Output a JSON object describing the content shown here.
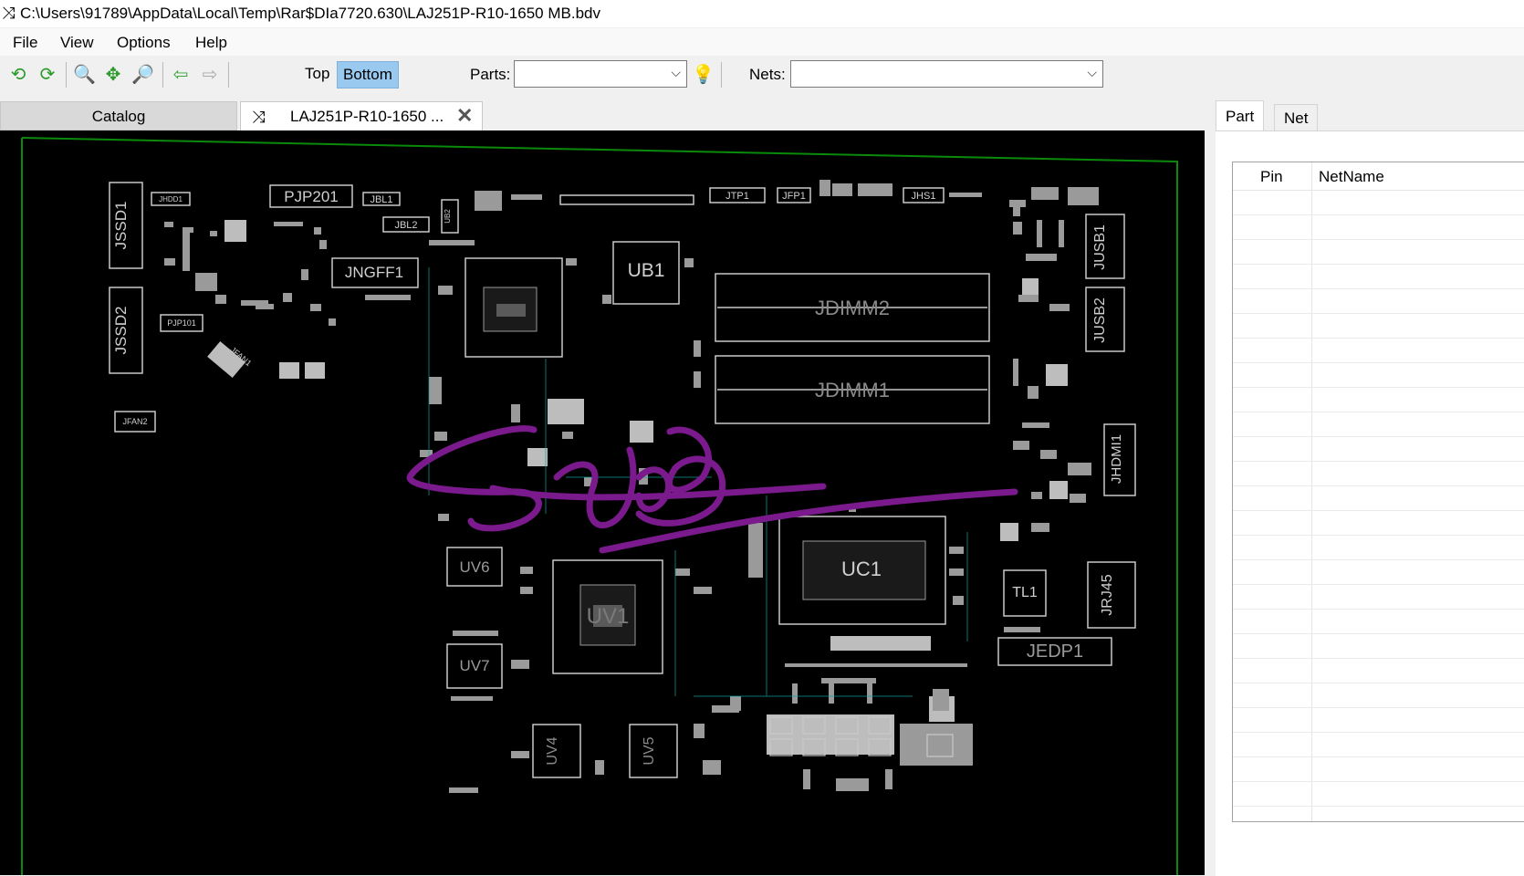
{
  "window": {
    "title": "C:\\Users\\91789\\AppData\\Local\\Temp\\Rar$DIa7720.630\\LAJ251P-R10-1650 MB.bdv",
    "icon": "shuffle-icon"
  },
  "menu": {
    "file": "File",
    "view": "View",
    "options": "Options",
    "help": "Help"
  },
  "toolbar": {
    "icons": [
      "refresh-icon",
      "reload-icon",
      "zoom-out-icon",
      "fit-icon",
      "zoom-in-icon",
      "back-arrow-icon",
      "forward-arrow-icon",
      "bulb-icon"
    ],
    "top_label": "Top",
    "bottom_label": "Bottom",
    "parts_label": "Parts:",
    "parts_value": "",
    "nets_label": "Nets:",
    "nets_value": ""
  },
  "tabs": {
    "catalog": "Catalog",
    "document": "LAJ251P-R10-1650 ...",
    "close_icon": "close-icon"
  },
  "board": {
    "components": [
      {
        "name": "PJP201",
        "label": "PJP201"
      },
      {
        "name": "JSSD1",
        "label": "JSSD1"
      },
      {
        "name": "JSSD2",
        "label": "JSSD2"
      },
      {
        "name": "JNGFF1",
        "label": "JNGFF1"
      },
      {
        "name": "UB1",
        "label": "UB1"
      },
      {
        "name": "JDIMM2",
        "label": "JDIMM2"
      },
      {
        "name": "JDIMM1",
        "label": "JDIMM1"
      },
      {
        "name": "JUSB1",
        "label": "JUSB1"
      },
      {
        "name": "JUSB2",
        "label": "JUSB2"
      },
      {
        "name": "JHDMI1",
        "label": "JHDMI1"
      },
      {
        "name": "UC1",
        "label": "UC1"
      },
      {
        "name": "UV6",
        "label": "UV6"
      },
      {
        "name": "UV1",
        "label": "UV1"
      },
      {
        "name": "UV7",
        "label": "UV7"
      },
      {
        "name": "UV4",
        "label": "UV4"
      },
      {
        "name": "UV5",
        "label": "UV5"
      },
      {
        "name": "TL1",
        "label": "TL1"
      },
      {
        "name": "JRJ45",
        "label": "JRJ45"
      },
      {
        "name": "JEDP1",
        "label": "JEDP1"
      },
      {
        "name": "JTP1",
        "label": "JTP1"
      },
      {
        "name": "JFP1",
        "label": "JFP1"
      },
      {
        "name": "JHS1",
        "label": "JHS1"
      },
      {
        "name": "JBL1",
        "label": "JBL1"
      },
      {
        "name": "JBL2",
        "label": "JBL2"
      },
      {
        "name": "PJP101",
        "label": "PJP101"
      },
      {
        "name": "JFAN1",
        "label": "JFAN1"
      },
      {
        "name": "JFAN2",
        "label": "JFAN2"
      },
      {
        "name": "JHDD1",
        "label": "JHDD1"
      },
      {
        "name": "UB2",
        "label": "UB2"
      }
    ]
  },
  "side_panel": {
    "tabs": {
      "part": "Part",
      "net": "Net"
    },
    "columns": {
      "pin": "Pin",
      "netname": "NetName"
    }
  },
  "colors": {
    "board_bg": "#000000",
    "board_outline": "#008000",
    "silkscreen": "#c8c8c8",
    "annotation": "#7a1a8c",
    "selected_button": "#99c9ef"
  }
}
